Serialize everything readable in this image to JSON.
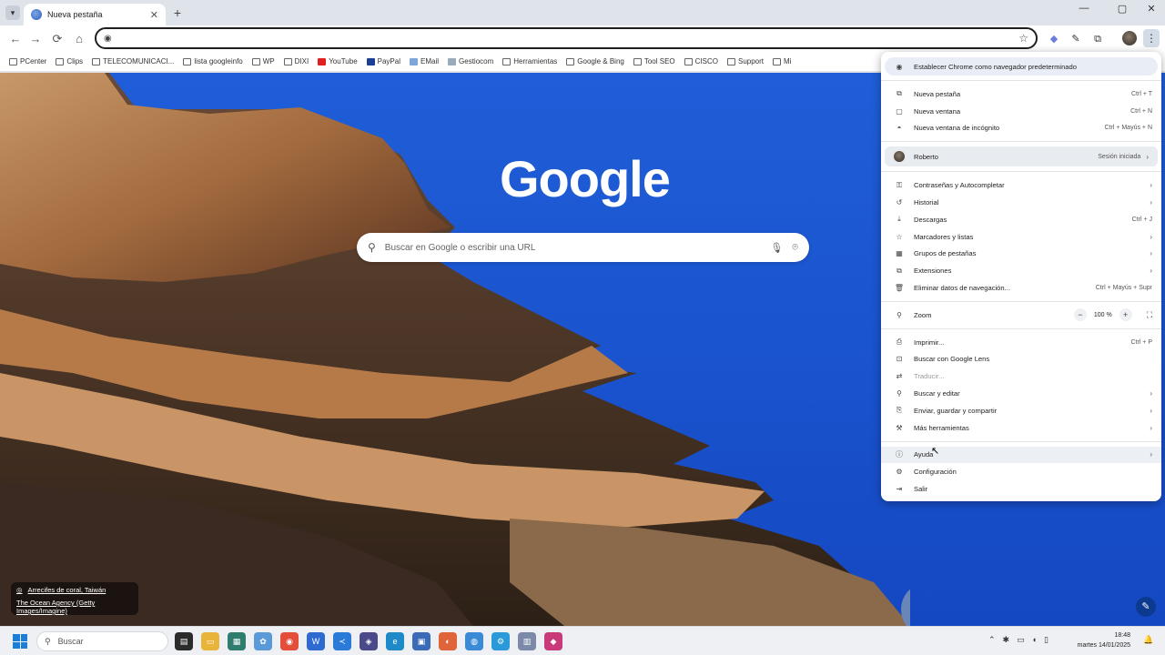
{
  "tab": {
    "title": "Nueva pestaña",
    "close": "✕",
    "new": "+",
    "search_arrow": "▾"
  },
  "window": {
    "minimize": "—",
    "maximize": "▢",
    "close": "✕"
  },
  "toolbar": {
    "back": "←",
    "forward": "→",
    "reload": "⟳",
    "home": "⌂",
    "url_value": "",
    "star": "☆"
  },
  "bookmarks": [
    {
      "label": "PCenter",
      "icon": "folder"
    },
    {
      "label": "Clips",
      "icon": "folder"
    },
    {
      "label": "TELECOMUNICACI...",
      "icon": "folder"
    },
    {
      "label": "lista googleinfo",
      "icon": "folder"
    },
    {
      "label": "WP",
      "icon": "folder"
    },
    {
      "label": "DIXI",
      "icon": "folder"
    },
    {
      "label": "YouTube",
      "icon": "youtube"
    },
    {
      "label": "PayPal",
      "icon": "paypal"
    },
    {
      "label": "EMail",
      "icon": "mail"
    },
    {
      "label": "Gestiocom",
      "icon": "grid"
    },
    {
      "label": "Herramientas",
      "icon": "folder"
    },
    {
      "label": "Google & Bing",
      "icon": "folder"
    },
    {
      "label": "Tool SEO",
      "icon": "folder"
    },
    {
      "label": "CISCO",
      "icon": "folder"
    },
    {
      "label": "Support",
      "icon": "folder"
    },
    {
      "label": "Mi",
      "icon": "folder"
    }
  ],
  "ntp": {
    "logo": "Google",
    "search_placeholder": "Buscar en Google o escribir una URL",
    "credit_line1": "Arrecifes de coral, Taiwán",
    "credit_line2": "The Ocean Agency (Getty Images/Imagine)"
  },
  "menu": {
    "banner": "Establecer Chrome como navegador predeterminado",
    "group1": [
      {
        "label": "Nueva pestaña",
        "shortcut": "Ctrl + T",
        "icon": "tab-icon"
      },
      {
        "label": "Nueva ventana",
        "shortcut": "Ctrl + N",
        "icon": "window-icon"
      },
      {
        "label": "Nueva ventana de incógnito",
        "shortcut": "Ctrl + Mayús + N",
        "icon": "incognito-icon"
      }
    ],
    "profile": {
      "name": "Roberto",
      "status": "Sesión iniciada"
    },
    "group2": [
      {
        "label": "Contraseñas y Autocompletar",
        "shortcut": "",
        "arrow": true
      },
      {
        "label": "Historial",
        "shortcut": "",
        "arrow": true
      },
      {
        "label": "Descargas",
        "shortcut": "Ctrl + J",
        "arrow": false
      },
      {
        "label": "Marcadores y listas",
        "shortcut": "",
        "arrow": true
      },
      {
        "label": "Grupos de pestañas",
        "shortcut": "",
        "arrow": true
      },
      {
        "label": "Extensiones",
        "shortcut": "",
        "arrow": true
      },
      {
        "label": "Eliminar datos de navegación...",
        "shortcut": "Ctrl + Mayús + Supr",
        "arrow": false
      }
    ],
    "zoom": {
      "label": "Zoom",
      "value": "100 %",
      "minus": "−",
      "plus": "+"
    },
    "group3": [
      {
        "label": "Imprimir...",
        "shortcut": "Ctrl + P",
        "arrow": false,
        "disabled": false
      },
      {
        "label": "Buscar con Google Lens",
        "shortcut": "",
        "arrow": false,
        "disabled": false
      },
      {
        "label": "Traducir...",
        "shortcut": "",
        "arrow": false,
        "disabled": true
      },
      {
        "label": "Buscar y editar",
        "shortcut": "",
        "arrow": true,
        "disabled": false
      },
      {
        "label": "Enviar, guardar y compartir",
        "shortcut": "",
        "arrow": true,
        "disabled": false
      },
      {
        "label": "Más herramientas",
        "shortcut": "",
        "arrow": true,
        "disabled": false
      }
    ],
    "group4": [
      {
        "label": "Ayuda",
        "arrow": true
      },
      {
        "label": "Configuración",
        "arrow": false
      },
      {
        "label": "Salir",
        "arrow": false
      }
    ]
  },
  "taskbar": {
    "search_placeholder": "Buscar",
    "time": "18:48",
    "date": "martes 14/01/2025"
  }
}
